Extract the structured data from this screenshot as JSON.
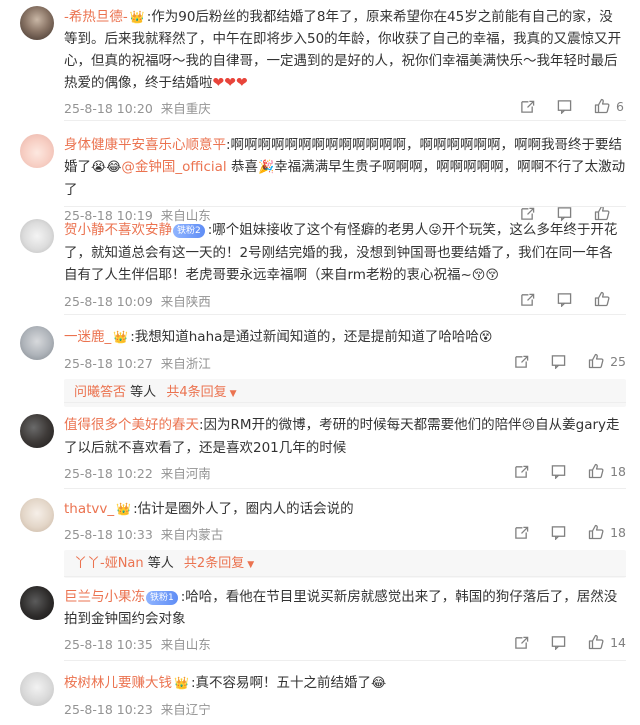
{
  "comments": [
    {
      "user": "-希热旦德-",
      "text": ":作为90后粉丝的我都结婚了8年了，原来希望你在45岁之前能有自己的家，没等到。后来我就释然了，中午在即将步入50的年龄，你收获了自己的幸福，我真的又震惊又开心，但真的祝福呀～我的自律哥，一定遇到的是好的人，祝你们幸福美满快乐～我年轻时最后热爱的偶像，终于结婚啦",
      "time": "25-8-18 10:20",
      "location": "来自重庆",
      "likes": "6"
    },
    {
      "user": "身体健康平安喜乐心顺意平",
      "text_a": ":啊啊啊啊啊啊啊啊啊啊啊啊啊，啊啊啊啊啊啊，啊啊我哥终于要结婚了",
      "mention": "@金钟国_official",
      "text_b": "恭喜",
      "text_c": "幸福满满早生贵子啊啊啊，啊啊啊啊啊，啊啊不行了太激动了",
      "time": "25-8-18 10:19",
      "location": "来自山东",
      "likes": ""
    },
    {
      "user": "贺小静不喜欢安静",
      "badge": "铁粉2",
      "text_a": ":哪个姐妹接收了这个有怪癖的老男人",
      "text_b": "开个玩笑，这么多年终于开花了，就知道总会有这一天的！2号刚结完婚的我，没想到钟国哥也要结婚了，我们在同一年各自有了人生伴侣耶！老虎哥要永远幸福啊（来自rm老粉的衷心祝福~",
      "time": "25-8-18 10:09",
      "location": "来自陕西",
      "likes": ""
    },
    {
      "user": "一迷鹿_",
      "text": ":我想知道haha是通过新闻知道的，还是提前知道了哈哈哈",
      "time": "25-8-18 10:27",
      "location": "来自浙江",
      "likes": "25",
      "reply_user": "问曦答否",
      "reply_mid": "等人",
      "reply_more": "共4条回复"
    },
    {
      "user": "值得很多个美好的春天",
      "text_a": ":因为RM开的微博，考研的时候每天都需要他们的陪伴",
      "text_b": "自从姜gary走了以后就不喜欢看了，还是喜欢201几年的时候",
      "time": "25-8-18 10:22",
      "location": "来自河南",
      "likes": "18"
    },
    {
      "user": "thatvv_",
      "text": ":估计是圈外人了，圈内人的话会说的",
      "time": "25-8-18 10:33",
      "location": "来自内蒙古",
      "likes": "18",
      "reply_user": "丫丫-娅Nan",
      "reply_mid": "等人",
      "reply_more": "共2条回复"
    },
    {
      "user": "巨兰与小果冻",
      "badge": "铁粉1",
      "text": ":哈哈，看他在节目里说买新房就感觉出来了，韩国的狗仔落后了，居然没拍到金钟国约会对象",
      "time": "25-8-18 10:35",
      "location": "来自山东",
      "likes": "14"
    },
    {
      "user": "桉树林儿要赚大钱",
      "text": ":真不容易啊！五十之前结婚了",
      "time": "25-8-18 10:23",
      "location": "来自辽宁",
      "likes": ""
    }
  ]
}
